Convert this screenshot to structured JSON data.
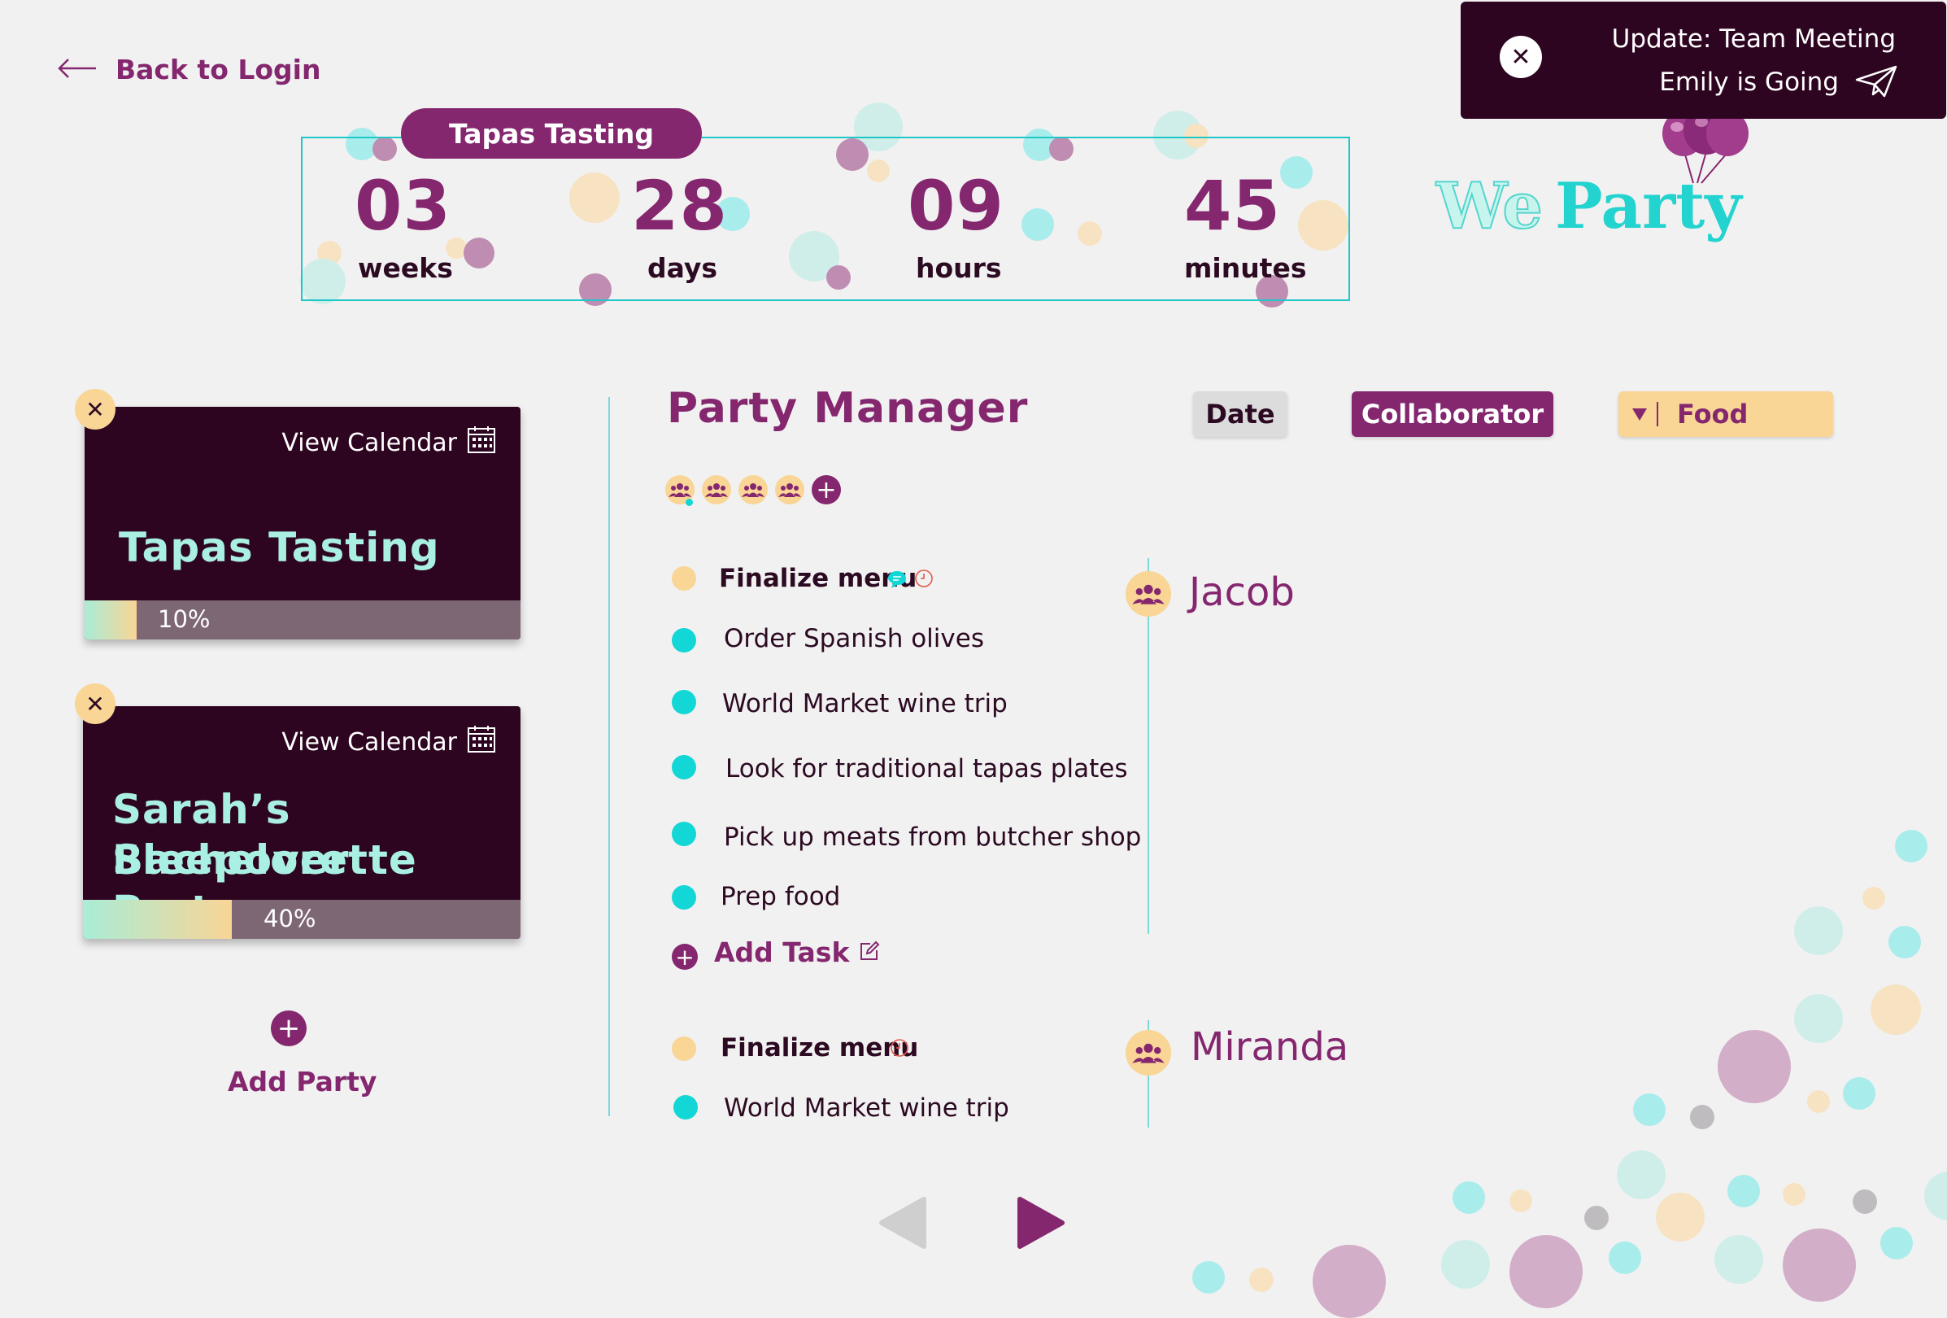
{
  "nav": {
    "back_label": "Back to Login"
  },
  "countdown": {
    "event": "Tapas Tasting",
    "units": [
      {
        "value": "03",
        "label": "weeks"
      },
      {
        "value": "28",
        "label": "days"
      },
      {
        "value": "09",
        "label": "hours"
      },
      {
        "value": "45",
        "label": "minutes"
      }
    ]
  },
  "toast": {
    "line1": "Update: Team Meeting",
    "line2": "Emily is Going"
  },
  "logo": {
    "text_we": "We",
    "text_party": "Party"
  },
  "parties": [
    {
      "view_calendar": "View Calendar",
      "title": "Tapas Tasting",
      "progress_label": "10%",
      "progress": 0.12
    },
    {
      "view_calendar": "View Calendar",
      "title_line1": "Sarah’s Sleepover",
      "title_line2": "Bachelorette Party",
      "progress_label": "40%",
      "progress": 0.34
    }
  ],
  "add_party_label": "Add Party",
  "manager": {
    "title": "Party Manager",
    "filters": {
      "date": "Date",
      "collaborator": "Collaborator",
      "food": "Food"
    },
    "add_task_label": "Add Task"
  },
  "groups": [
    {
      "collaborator": "Jacob",
      "tasks": [
        {
          "label": "Finalize menu",
          "bold": true,
          "status": "pending"
        },
        {
          "label": "Order Spanish olives",
          "status": "done"
        },
        {
          "label": "World Market wine trip",
          "status": "done"
        },
        {
          "label": "Look for traditional tapas plates",
          "status": "done"
        },
        {
          "label": "Pick up meats from butcher shop",
          "status": "done"
        },
        {
          "label": "Prep food",
          "status": "done"
        }
      ]
    },
    {
      "collaborator": "Miranda",
      "tasks": [
        {
          "label": "Finalize menu",
          "bold": true,
          "status": "pending"
        },
        {
          "label": "World Market wine trip",
          "status": "done"
        }
      ]
    }
  ],
  "colors": {
    "plum": "#84276f",
    "dark": "#2e0520",
    "teal": "#13d6d6",
    "peach": "#f9d596"
  }
}
